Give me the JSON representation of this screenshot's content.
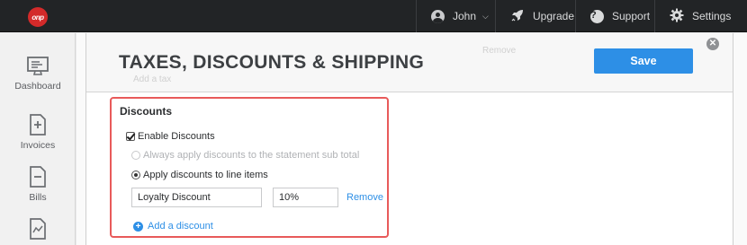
{
  "brand": {
    "logo_text": "onp",
    "accent": "#d32a2a"
  },
  "topbar": {
    "user_name": "John",
    "upgrade_label": "Upgrade",
    "support_label": "Support",
    "settings_label": "Settings"
  },
  "sidebar": {
    "items": [
      {
        "label": "Dashboard",
        "icon": "monitor-icon"
      },
      {
        "label": "Invoices",
        "icon": "invoice-plus-icon"
      },
      {
        "label": "Bills",
        "icon": "bill-minus-icon"
      },
      {
        "label": "",
        "icon": "report-chart-icon"
      }
    ]
  },
  "modal": {
    "title": "TAXES, DISCOUNTS & SHIPPING",
    "save_label": "Save",
    "ghost_remove": "Remove",
    "ghost_add": "Add a tax",
    "accent": "#2d8fe6"
  },
  "discounts": {
    "section_title": "Discounts",
    "enable_label": "Enable Discounts",
    "enable_checked": true,
    "option_subtotal": "Always apply discounts to the statement sub total",
    "option_line_items": "Apply discounts to line items",
    "selected_option": "line_items",
    "discount_name": "Loyalty Discount",
    "discount_rate": "10%",
    "remove_label": "Remove",
    "add_label": "Add a discount",
    "highlight_color": "#e85a5a"
  }
}
